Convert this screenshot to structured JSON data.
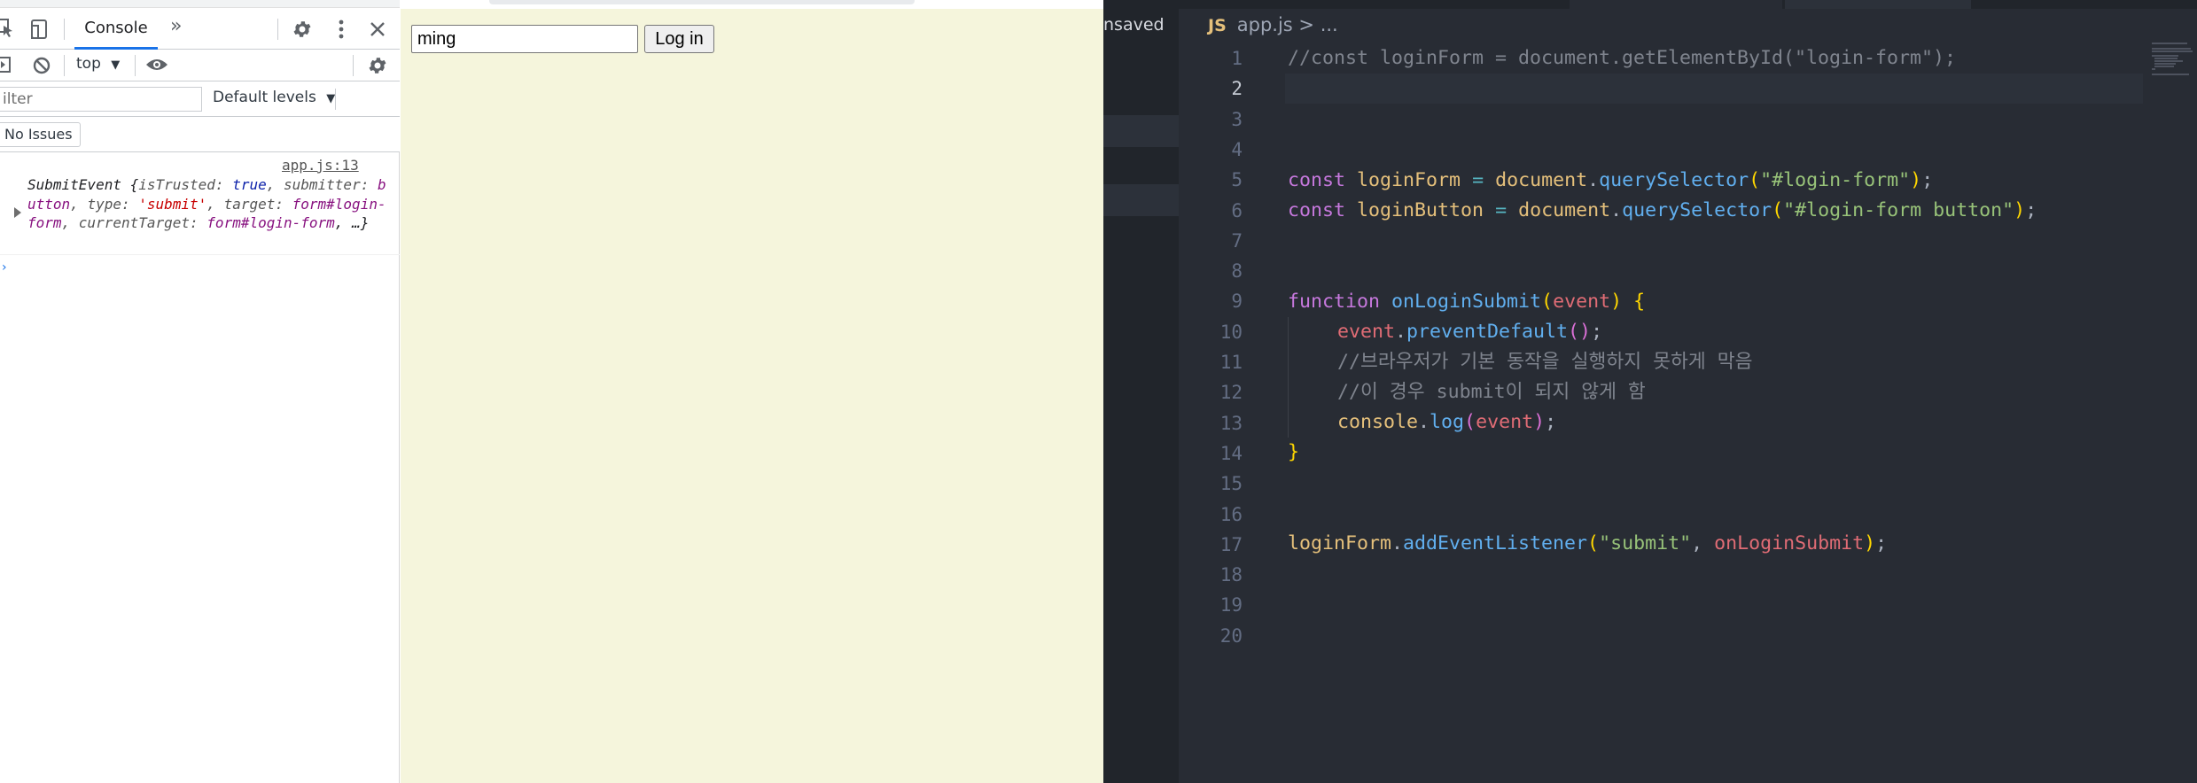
{
  "devtools": {
    "tabs": {
      "console": "Console",
      "more": "»"
    },
    "context": "top",
    "filter_placeholder": "ilter",
    "levels": "Default levels",
    "issues": "No Issues",
    "log": {
      "source": "app.js:13",
      "class_name": "SubmitEvent",
      "open_brace": " {",
      "key_trusted": "isTrusted: ",
      "val_trusted": "true",
      "key_submitter": ", submitter: ",
      "val_submitter": "button",
      "key_type": ", type: ",
      "val_type": "'submit'",
      "key_target": ", target: ",
      "val_target": "form#login-form",
      "key_current": ", currentTarget: ",
      "val_current": "form#login-form",
      "tail": ", …}"
    }
  },
  "page": {
    "login_input_value": "ming",
    "login_button": "Log in"
  },
  "editor": {
    "unsaved": "nsaved",
    "breadcrumb": {
      "lang": "JS",
      "file": "app.js",
      "sep": " > ",
      "rest": "..."
    },
    "line_numbers": [
      "1",
      "2",
      "3",
      "4",
      "5",
      "6",
      "7",
      "8",
      "9",
      "10",
      "11",
      "12",
      "13",
      "14",
      "15",
      "16",
      "17",
      "18",
      "19",
      "20"
    ],
    "lines": {
      "l1": "//const loginForm = document.getElementById(\"login-form\");",
      "l5a": "const",
      "l5b": "loginForm",
      "l5c": "document",
      "l5d": "querySelector",
      "l5e": "\"#login-form\"",
      "l6a": "const",
      "l6b": "loginButton",
      "l6c": "document",
      "l6d": "querySelector",
      "l6e": "\"#login-form button\"",
      "l9a": "function",
      "l9b": "onLoginSubmit",
      "l9c": "event",
      "l10a": "event",
      "l10b": "preventDefault",
      "l11": "//브라우저가 기본 동작을 실행하지 못하게 막음",
      "l12": "//이 경우 submit이 되지 않게 함",
      "l13a": "console",
      "l13b": "log",
      "l13c": "event",
      "l17a": "loginForm",
      "l17b": "addEventListener",
      "l17c": "\"submit\"",
      "l17d": "onLoginSubmit"
    }
  }
}
